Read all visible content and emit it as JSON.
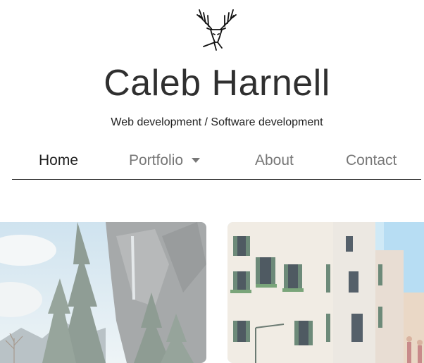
{
  "header": {
    "logo_icon": "deer-antlers-icon",
    "title": "Caleb Harnell",
    "tagline": "Web development / Software development"
  },
  "nav": {
    "items": [
      {
        "label": "Home",
        "active": true
      },
      {
        "label": "Portfolio",
        "active": false,
        "has_dropdown": true
      },
      {
        "label": "About",
        "active": false
      },
      {
        "label": "Contact",
        "active": false
      }
    ]
  },
  "portfolio_cards": [
    {
      "image": "mountain-waterfall-with-trees-photo"
    },
    {
      "image": "venetian-buildings-street-photo"
    }
  ],
  "colors": {
    "title": "#2f2f2f",
    "nav_active": "#222222",
    "nav_inactive": "#777777",
    "divider": "#222222"
  }
}
